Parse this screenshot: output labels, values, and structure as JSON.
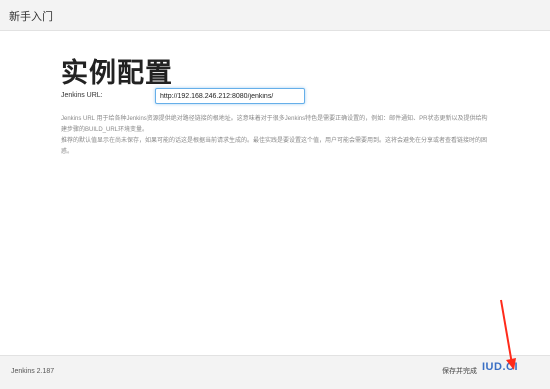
{
  "header": {
    "title": "新手入门"
  },
  "page": {
    "title": "实例配置"
  },
  "form": {
    "url_label": "Jenkins URL:",
    "url_value": "http://192.168.246.212:8080/jenkins/"
  },
  "help": {
    "paragraph1": "Jenkins URL 用于给各种Jenkins资源提供绝对路径链接的根地址。这意味着对于很多Jenkins特色是需要正确设置的，例如：邮件通知、PR状态更新以及提供给构建步骤的BUILD_URL环境变量。",
    "paragraph2": "推荐的默认值显示在尚未保存，如果可能的话这是根据当前请求生成的。最佳实践是要设置这个值，用户可能会需要用到。这将会避免在分享或者查看链接时的困惑。"
  },
  "footer": {
    "version": "Jenkins 2.187",
    "button_label": "保存并完成"
  },
  "watermark": {
    "text": "IUD.CI"
  },
  "colors": {
    "focus": "#66afe9",
    "annotation": "#ff2a1a"
  }
}
